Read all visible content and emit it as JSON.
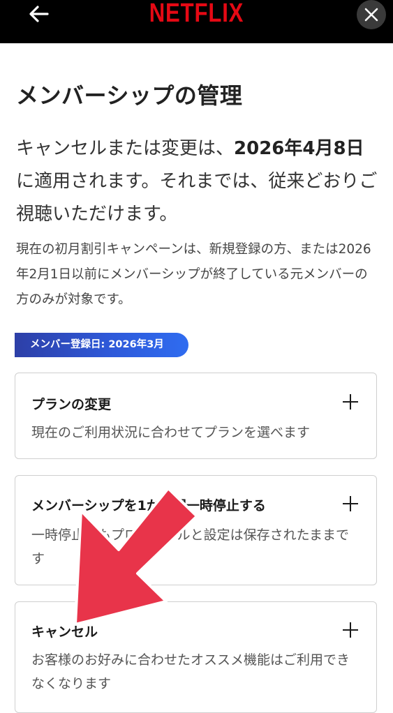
{
  "header": {
    "logo": "NETFLIX",
    "back_icon": "back-arrow-icon",
    "close_icon": "close-icon"
  },
  "page": {
    "title": "メンバーシップの管理",
    "lead_prefix": "キャンセルまたは変更は、",
    "lead_date": "2026年4月8日",
    "lead_suffix": "に適用されます。それまでは、従来どおりご視聴いただけます。",
    "note": "現在の初月割引キャンペーンは、新規登録の方、または2026年2月1日以前にメンバーシップが終了している元メンバーの方のみが対象です。",
    "badge": "メンバー登録日: 2026年3月"
  },
  "cards": [
    {
      "title": "プランの変更",
      "desc": "現在のご利用状況に合わせてプランを選べます"
    },
    {
      "title": "メンバーシップを1か月間一時停止する",
      "desc": "一時停止中もプロフィールと設定は保存されたままです"
    },
    {
      "title": "キャンセル",
      "desc": "お客様のお好みに合わせたオススメ機能はご利用できなくなります"
    }
  ],
  "colors": {
    "brand": "#e50914",
    "annotation_arrow": "#e8344a",
    "badge_start": "#2d3fa7",
    "badge_end": "#2f6cf0"
  }
}
